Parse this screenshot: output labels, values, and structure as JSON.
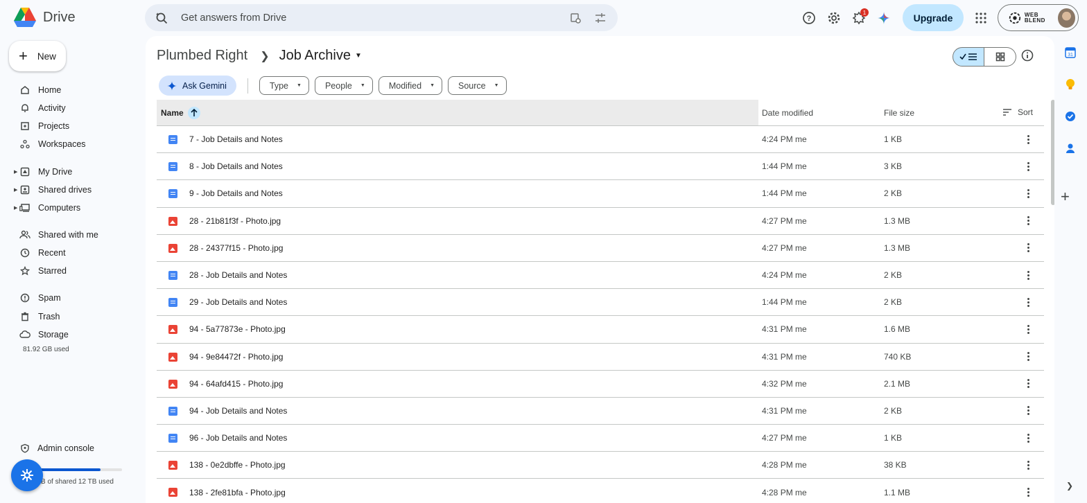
{
  "app": {
    "name": "Drive"
  },
  "search": {
    "placeholder": "Get answers from Drive"
  },
  "header": {
    "upgrade_label": "Upgrade",
    "notifications_count": "1",
    "account_brand": "WEB BLEND"
  },
  "sidebar": {
    "new_label": "New",
    "items": [
      {
        "label": "Home",
        "icon": "home-icon"
      },
      {
        "label": "Activity",
        "icon": "bell-icon"
      },
      {
        "label": "Projects",
        "icon": "projects-icon"
      },
      {
        "label": "Workspaces",
        "icon": "workspaces-icon"
      },
      {
        "label": "My Drive",
        "icon": "my-drive-icon"
      },
      {
        "label": "Shared drives",
        "icon": "shared-drives-icon"
      },
      {
        "label": "Computers",
        "icon": "computers-icon"
      },
      {
        "label": "Shared with me",
        "icon": "people-icon"
      },
      {
        "label": "Recent",
        "icon": "clock-icon"
      },
      {
        "label": "Starred",
        "icon": "star-icon"
      },
      {
        "label": "Spam",
        "icon": "spam-icon"
      },
      {
        "label": "Trash",
        "icon": "trash-icon"
      },
      {
        "label": "Storage",
        "icon": "cloud-icon"
      }
    ],
    "storage_used": "81.92 GB used",
    "admin_label": "Admin console",
    "shared_storage": "B of shared 12 TB used"
  },
  "breadcrumb": {
    "parent": "Plumbed Right",
    "current": "Job Archive"
  },
  "filters": {
    "gemini": "Ask Gemini",
    "chips": [
      "Type",
      "People",
      "Modified",
      "Source"
    ]
  },
  "table": {
    "columns": {
      "name": "Name",
      "date": "Date modified",
      "size": "File size",
      "sort": "Sort"
    },
    "rows": [
      {
        "name": "7 - Job Details and Notes",
        "type": "doc",
        "date": "4:24 PM me",
        "size": "1 KB"
      },
      {
        "name": "8 - Job Details and Notes",
        "type": "doc",
        "date": "1:44 PM me",
        "size": "3 KB"
      },
      {
        "name": "9 - Job Details and Notes",
        "type": "doc",
        "date": "1:44 PM me",
        "size": "2 KB"
      },
      {
        "name": "28 - 21b81f3f - Photo.jpg",
        "type": "img",
        "date": "4:27 PM me",
        "size": "1.3 MB"
      },
      {
        "name": "28 - 24377f15 - Photo.jpg",
        "type": "img",
        "date": "4:27 PM me",
        "size": "1.3 MB"
      },
      {
        "name": "28 - Job Details and Notes",
        "type": "doc",
        "date": "4:24 PM me",
        "size": "2 KB"
      },
      {
        "name": "29 - Job Details and Notes",
        "type": "doc",
        "date": "1:44 PM me",
        "size": "2 KB"
      },
      {
        "name": "94 - 5a77873e - Photo.jpg",
        "type": "img",
        "date": "4:31 PM me",
        "size": "1.6 MB"
      },
      {
        "name": "94 - 9e84472f - Photo.jpg",
        "type": "img",
        "date": "4:31 PM me",
        "size": "740 KB"
      },
      {
        "name": "94 - 64afd415 - Photo.jpg",
        "type": "img",
        "date": "4:32 PM me",
        "size": "2.1 MB"
      },
      {
        "name": "94 - Job Details and Notes",
        "type": "doc",
        "date": "4:31 PM me",
        "size": "2 KB"
      },
      {
        "name": "96 - Job Details and Notes",
        "type": "doc",
        "date": "4:27 PM me",
        "size": "1 KB"
      },
      {
        "name": "138 - 0e2dbffe - Photo.jpg",
        "type": "img",
        "date": "4:28 PM me",
        "size": "38 KB"
      },
      {
        "name": "138 - 2fe81bfa - Photo.jpg",
        "type": "img",
        "date": "4:28 PM me",
        "size": "1.1 MB"
      }
    ]
  },
  "colors": {
    "accent": "#0b57d0",
    "selected": "#c2e7ff",
    "doc": "#4285f4",
    "image": "#ea4335"
  }
}
